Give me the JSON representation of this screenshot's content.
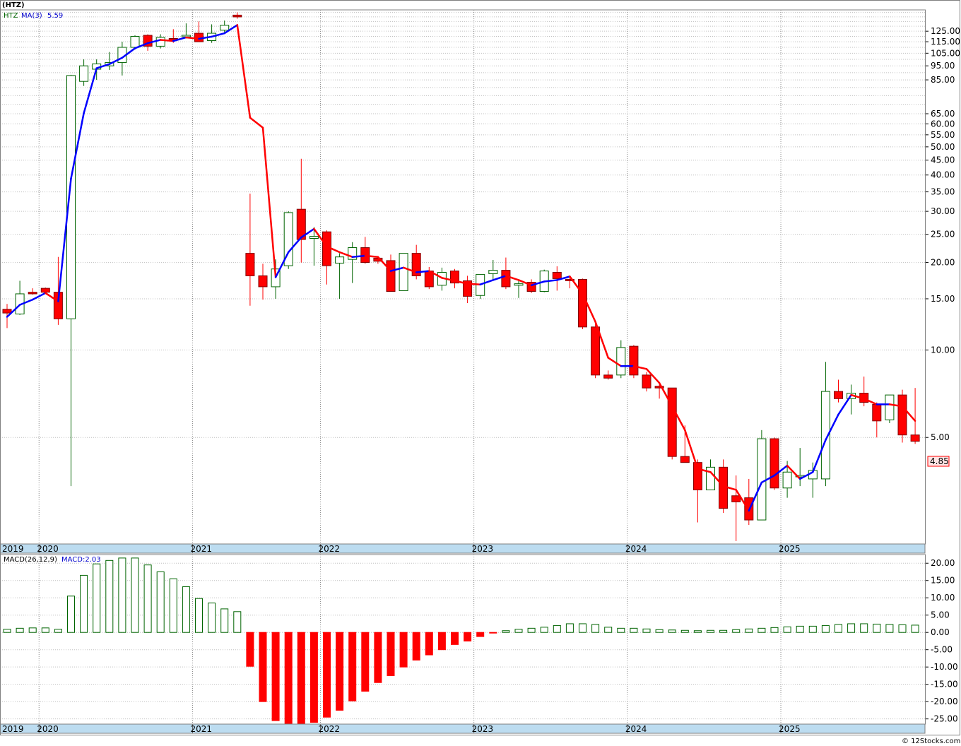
{
  "header": {
    "symbol": "(HTZ)"
  },
  "price_legend": {
    "ticker": "HTZ",
    "ma_label": "MA(3)",
    "ma_value": "5.59",
    "last_price": "4.85"
  },
  "macd_legend": {
    "label": "MACD(26,12,9)",
    "value": "MACD:2.03"
  },
  "watermark": "© 12Stocks.com",
  "colors": {
    "up": "#006400",
    "down": "#ff0000",
    "ma_up": "#0000ff",
    "ma_down": "#ff0000",
    "axis_band": "#bcdcf0",
    "grid": "#c0c0c0",
    "year_grid": "#8c8c8c"
  },
  "chart_data": [
    {
      "type": "candlestick",
      "title": "(HTZ)",
      "scale": "log",
      "ylim": [
        2.15,
        148
      ],
      "ytick_labels": [
        "5.00",
        "10.00",
        "15.00",
        "20.00",
        "25.00",
        "30.00",
        "35.00",
        "40.00",
        "45.00",
        "50.00",
        "55.00",
        "60.00",
        "65.00",
        "85.00",
        "95.00",
        "105.00",
        "115.00",
        "125.00"
      ],
      "ytick_values": [
        5,
        10,
        15,
        20,
        25,
        30,
        35,
        40,
        45,
        50,
        55,
        60,
        65,
        85,
        95,
        105,
        115,
        125
      ],
      "minor_grid": [
        70,
        75,
        80,
        90,
        100,
        110,
        120,
        130,
        135,
        140,
        145
      ],
      "x_years": [
        {
          "label": "2019",
          "month": 0
        },
        {
          "label": "2020",
          "month": 3
        },
        {
          "label": "2021",
          "month": 15
        },
        {
          "label": "2022",
          "month": 25
        },
        {
          "label": "2023",
          "month": 37
        },
        {
          "label": "2024",
          "month": 49
        },
        {
          "label": "2025",
          "month": 61
        }
      ],
      "candles": [
        {
          "o": 13.8,
          "h": 14.4,
          "l": 11.9,
          "c": 13.4
        },
        {
          "o": 13.3,
          "h": 17.3,
          "l": 13.2,
          "c": 15.6
        },
        {
          "o": 15.8,
          "h": 16.3,
          "l": 15.5,
          "c": 15.6
        },
        {
          "o": 16.3,
          "h": 16.4,
          "l": 15.7,
          "c": 15.8
        },
        {
          "o": 15.8,
          "h": 20.9,
          "l": 12.2,
          "c": 12.8
        },
        {
          "o": 12.8,
          "h": 88.5,
          "l": 3.4,
          "c": 88.0
        },
        {
          "o": 84.0,
          "h": 100.0,
          "l": 81.0,
          "c": 95.0
        },
        {
          "o": 92.5,
          "h": 100.0,
          "l": 85.0,
          "c": 96.5
        },
        {
          "o": 95.0,
          "h": 106.0,
          "l": 92.0,
          "c": 97.5
        },
        {
          "o": 97.5,
          "h": 115.0,
          "l": 88.0,
          "c": 110.0
        },
        {
          "o": 110.0,
          "h": 121.0,
          "l": 108.0,
          "c": 120.0
        },
        {
          "o": 121.0,
          "h": 122.0,
          "l": 107.0,
          "c": 111.0
        },
        {
          "o": 111.0,
          "h": 122.0,
          "l": 109.0,
          "c": 119.0
        },
        {
          "o": 118.0,
          "h": 127.0,
          "l": 114.0,
          "c": 117.0
        },
        {
          "o": 120.0,
          "h": 133.0,
          "l": 118.0,
          "c": 121.0
        },
        {
          "o": 123.0,
          "h": 135.0,
          "l": 115.0,
          "c": 115.0
        },
        {
          "o": 116.0,
          "h": 132.0,
          "l": 114.0,
          "c": 123.0
        },
        {
          "o": 126.0,
          "h": 136.0,
          "l": 124.0,
          "c": 131.0
        },
        {
          "o": 142.0,
          "h": 145.0,
          "l": 138.0,
          "c": 140.0
        },
        {
          "o": 21.5,
          "h": 34.5,
          "l": 14.2,
          "c": 18.0
        },
        {
          "o": 18.0,
          "h": 19.8,
          "l": 14.9,
          "c": 16.5
        },
        {
          "o": 16.5,
          "h": 20.5,
          "l": 15.0,
          "c": 19.0
        },
        {
          "o": 19.5,
          "h": 30.0,
          "l": 19.0,
          "c": 29.7
        },
        {
          "o": 30.5,
          "h": 45.5,
          "l": 20.0,
          "c": 24.0
        },
        {
          "o": 24.2,
          "h": 26.5,
          "l": 19.5,
          "c": 24.6
        },
        {
          "o": 25.5,
          "h": 25.8,
          "l": 16.8,
          "c": 19.5
        },
        {
          "o": 19.9,
          "h": 21.5,
          "l": 15.0,
          "c": 20.9
        },
        {
          "o": 20.5,
          "h": 23.5,
          "l": 17.0,
          "c": 22.5
        },
        {
          "o": 22.5,
          "h": 24.5,
          "l": 19.8,
          "c": 20.0
        },
        {
          "o": 20.7,
          "h": 21.0,
          "l": 19.8,
          "c": 20.2
        },
        {
          "o": 20.3,
          "h": 21.3,
          "l": 15.9,
          "c": 15.9
        },
        {
          "o": 16.0,
          "h": 21.5,
          "l": 16.0,
          "c": 21.5
        },
        {
          "o": 21.5,
          "h": 23.0,
          "l": 17.5,
          "c": 18.0
        },
        {
          "o": 18.7,
          "h": 19.3,
          "l": 16.2,
          "c": 16.5
        },
        {
          "o": 16.7,
          "h": 19.2,
          "l": 16.0,
          "c": 18.5
        },
        {
          "o": 18.7,
          "h": 19.0,
          "l": 16.3,
          "c": 17.0
        },
        {
          "o": 17.3,
          "h": 18.0,
          "l": 14.5,
          "c": 15.3
        },
        {
          "o": 15.4,
          "h": 18.0,
          "l": 15.0,
          "c": 18.2
        },
        {
          "o": 18.3,
          "h": 20.4,
          "l": 17.5,
          "c": 18.8
        },
        {
          "o": 18.8,
          "h": 20.8,
          "l": 16.2,
          "c": 16.5
        },
        {
          "o": 16.7,
          "h": 17.3,
          "l": 15.1,
          "c": 16.9
        },
        {
          "o": 17.1,
          "h": 17.5,
          "l": 15.7,
          "c": 15.9
        },
        {
          "o": 15.9,
          "h": 18.9,
          "l": 15.8,
          "c": 18.7
        },
        {
          "o": 18.5,
          "h": 19.4,
          "l": 16.0,
          "c": 17.6
        },
        {
          "o": 17.5,
          "h": 17.9,
          "l": 16.3,
          "c": 17.3
        },
        {
          "o": 17.5,
          "h": 17.6,
          "l": 11.8,
          "c": 12.0
        },
        {
          "o": 12.0,
          "h": 12.3,
          "l": 8.0,
          "c": 8.2
        },
        {
          "o": 8.2,
          "h": 8.5,
          "l": 7.9,
          "c": 8.0
        },
        {
          "o": 8.2,
          "h": 10.8,
          "l": 8.0,
          "c": 10.2
        },
        {
          "o": 10.3,
          "h": 10.4,
          "l": 8.0,
          "c": 8.2
        },
        {
          "o": 8.2,
          "h": 8.4,
          "l": 7.2,
          "c": 7.4
        },
        {
          "o": 7.5,
          "h": 7.6,
          "l": 6.8,
          "c": 7.4
        },
        {
          "o": 7.4,
          "h": 7.4,
          "l": 4.2,
          "c": 4.3
        },
        {
          "o": 4.3,
          "h": 5.5,
          "l": 4.1,
          "c": 4.1
        },
        {
          "o": 4.1,
          "h": 4.2,
          "l": 2.55,
          "c": 3.3
        },
        {
          "o": 3.3,
          "h": 4.2,
          "l": 3.3,
          "c": 3.95
        },
        {
          "o": 3.95,
          "h": 4.2,
          "l": 2.75,
          "c": 2.85
        },
        {
          "o": 3.15,
          "h": 3.7,
          "l": 2.2,
          "c": 3.0
        },
        {
          "o": 3.1,
          "h": 3.6,
          "l": 2.5,
          "c": 2.6
        },
        {
          "o": 2.6,
          "h": 5.3,
          "l": 2.6,
          "c": 4.95
        },
        {
          "o": 4.95,
          "h": 5.0,
          "l": 3.3,
          "c": 3.35
        },
        {
          "o": 3.35,
          "h": 4.15,
          "l": 3.1,
          "c": 3.8
        },
        {
          "o": 3.7,
          "h": 4.6,
          "l": 3.4,
          "c": 3.7
        },
        {
          "o": 3.6,
          "h": 4.1,
          "l": 3.1,
          "c": 3.85
        },
        {
          "o": 3.6,
          "h": 9.1,
          "l": 3.4,
          "c": 7.2
        },
        {
          "o": 7.2,
          "h": 7.9,
          "l": 6.6,
          "c": 6.8
        },
        {
          "o": 6.8,
          "h": 7.6,
          "l": 6.0,
          "c": 7.1
        },
        {
          "o": 7.1,
          "h": 8.1,
          "l": 6.4,
          "c": 6.6
        },
        {
          "o": 6.5,
          "h": 6.6,
          "l": 5.0,
          "c": 5.7
        },
        {
          "o": 5.75,
          "h": 6.7,
          "l": 5.6,
          "c": 7.0
        },
        {
          "o": 7.0,
          "h": 7.3,
          "l": 4.8,
          "c": 5.1
        },
        {
          "o": 5.1,
          "h": 7.4,
          "l": 4.75,
          "c": 4.85
        }
      ],
      "ma3": [
        13.0,
        14.3,
        14.9,
        15.7,
        14.7,
        38.9,
        65.3,
        93.2,
        96.3,
        101.3,
        109.2,
        113.7,
        116.7,
        115.7,
        119.0,
        117.7,
        119.7,
        123.0,
        131.3,
        63.0,
        58.2,
        17.8,
        21.7,
        24.4,
        26.1,
        22.7,
        21.7,
        20.9,
        21.1,
        20.9,
        18.7,
        19.2,
        18.5,
        18.7,
        17.7,
        17.3,
        16.9,
        16.8,
        17.4,
        18.0,
        17.4,
        16.7,
        17.2,
        17.4,
        17.9,
        15.6,
        12.5,
        9.4,
        8.8,
        8.8,
        8.6,
        7.7,
        6.4,
        5.3,
        3.9,
        3.8,
        3.4,
        3.3,
        2.8,
        3.5,
        3.7,
        4.0,
        3.6,
        3.8,
        4.9,
        6.0,
        7.0,
        6.8,
        6.5,
        6.5,
        6.4,
        5.7
      ],
      "ma_up": [
        true,
        true,
        true,
        true,
        false,
        true,
        true,
        true,
        true,
        true,
        true,
        true,
        true,
        false,
        true,
        false,
        true,
        true,
        true,
        false,
        false,
        false,
        true,
        true,
        true,
        false,
        false,
        false,
        true,
        false,
        false,
        true,
        false,
        true,
        false,
        false,
        false,
        false,
        true,
        true,
        false,
        false,
        true,
        true,
        true,
        false,
        false,
        false,
        false,
        true,
        false,
        false,
        false,
        false,
        false,
        false,
        false,
        false,
        false,
        true,
        true,
        true,
        false,
        true,
        true,
        true,
        true,
        false,
        false,
        true,
        false,
        false
      ]
    },
    {
      "type": "bar",
      "title": "MACD(26,12,9)",
      "ylim": [
        -26.5,
        22.5
      ],
      "ytick_labels": [
        "20.00",
        "15.00",
        "10.00",
        "5.00",
        "0.00",
        "-5.00",
        "-10.00",
        "-15.00",
        "-20.00",
        "-25.00"
      ],
      "ytick_values": [
        20,
        15,
        10,
        5,
        0,
        -5,
        -10,
        -15,
        -20,
        -25
      ],
      "values": [
        0.9,
        1.2,
        1.3,
        1.3,
        0.9,
        10.5,
        16.5,
        19.8,
        20.8,
        21.5,
        21.5,
        19.5,
        17.5,
        15.5,
        13.2,
        9.8,
        8.5,
        6.8,
        6.0,
        -9.8,
        -20.0,
        -25.5,
        -26.5,
        -26.5,
        -26.0,
        -24.5,
        -22.5,
        -19.8,
        -17.0,
        -14.5,
        -12.5,
        -10.0,
        -8.0,
        -6.5,
        -5.0,
        -3.5,
        -2.5,
        -1.2,
        -0.2,
        0.5,
        0.9,
        1.2,
        1.5,
        2.0,
        2.5,
        2.5,
        2.3,
        1.5,
        1.2,
        1.2,
        1.0,
        0.8,
        0.7,
        0.6,
        0.5,
        0.6,
        0.6,
        0.8,
        1.0,
        1.2,
        1.4,
        1.6,
        1.8,
        1.8,
        2.0,
        2.3,
        2.5,
        2.5,
        2.4,
        2.3,
        2.2,
        2.1
      ]
    }
  ]
}
